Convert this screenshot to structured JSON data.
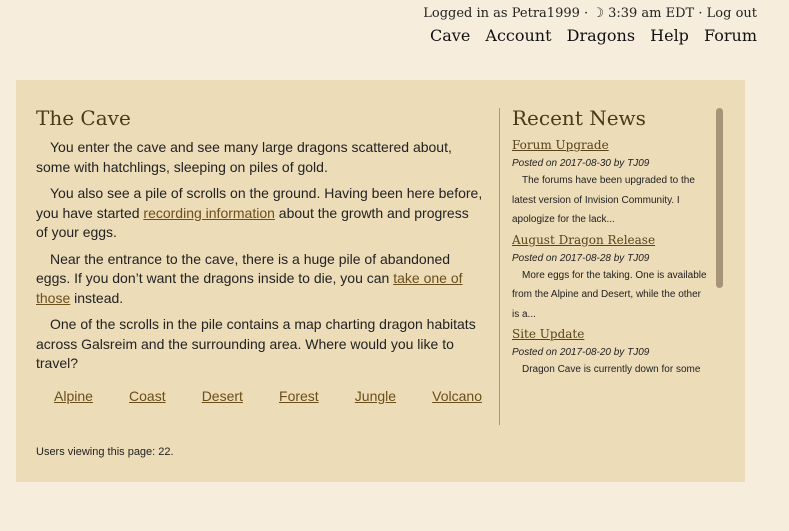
{
  "header": {
    "user": {
      "logged_in_as": "Logged in as",
      "username": "Petra1999",
      "sep1": "·",
      "moon_icon": "☽",
      "time": "3:39 am EDT",
      "sep2": "·",
      "logout": "Log out"
    },
    "nav": [
      "Cave",
      "Account",
      "Dragons",
      "Help",
      "Forum"
    ]
  },
  "main": {
    "title": "The Cave",
    "p1": "You enter the cave and see many large dragons scattered about, some with hatchlings, sleeping on piles of gold.",
    "p2_before": "You also see a pile of scrolls on the ground. Having been here before, you have started ",
    "p2_link": "recording information",
    "p2_after": " about the growth and progress of your eggs.",
    "p3_before": "Near the entrance to the cave, there is a huge pile of abandoned eggs. If you don’t want the dragons inside to die, you can ",
    "p3_link": "take one of those",
    "p3_after": " instead.",
    "p4": "One of the scrolls in the pile contains a map charting dragon habitats across Galsreim and the surrounding area. Where would you like to travel?",
    "habitats": [
      "Alpine",
      "Coast",
      "Desert",
      "Forest",
      "Jungle",
      "Volcano"
    ],
    "users_viewing": "Users viewing this page: 22."
  },
  "news": {
    "title": "Recent News",
    "items": [
      {
        "title": "Forum Upgrade",
        "meta": "Posted on 2017-08-30 by TJ09",
        "body": "The forums have been upgraded to the latest version of Invision Community. I apologize for the lack..."
      },
      {
        "title": "August Dragon Release",
        "meta": "Posted on 2017-08-28 by TJ09",
        "body": "More eggs for the taking. One is available from the Alpine and Desert, while the other is a..."
      },
      {
        "title": "Site Update",
        "meta": "Posted on 2017-08-20 by TJ09",
        "body": "Dragon Cave is currently down for some"
      }
    ]
  }
}
